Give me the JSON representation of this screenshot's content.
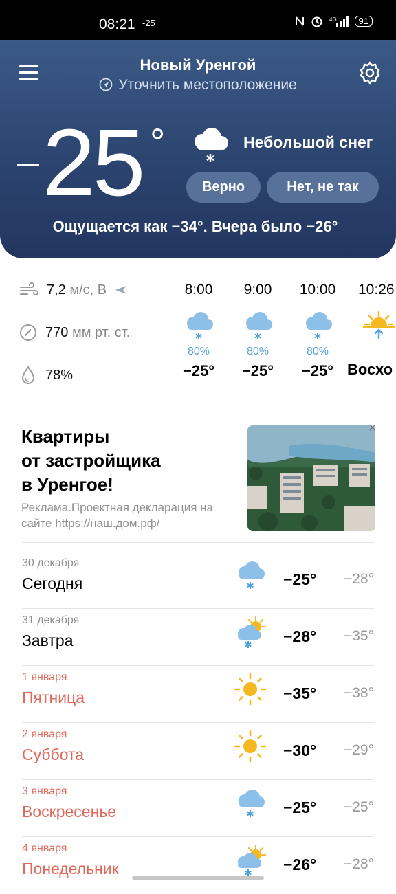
{
  "status_bar": {
    "time": "08:21",
    "temp": "-25",
    "battery": "91"
  },
  "header": {
    "city": "Новый Уренгой",
    "refine_location": "Уточнить местоположение",
    "temperature": "25",
    "degree": "°",
    "condition": "Небольшой снег",
    "btn_yes": "Верно",
    "btn_no": "Нет, не так",
    "feels_like": "Ощущается как −34°. Вчера было −26°"
  },
  "stats": {
    "wind_value": "7,2",
    "wind_unit": "м/с, В",
    "pressure_value": "770",
    "pressure_unit": "мм рт. ст.",
    "humidity": "78%"
  },
  "hourly": [
    {
      "time": "8:00",
      "prob": "80%",
      "temp": "−25°",
      "icon": "snow-cloud-icon"
    },
    {
      "time": "9:00",
      "prob": "80%",
      "temp": "−25°",
      "icon": "snow-cloud-icon"
    },
    {
      "time": "10:00",
      "prob": "80%",
      "temp": "−25°",
      "icon": "snow-cloud-icon"
    },
    {
      "time": "10:26",
      "prob": "",
      "temp": "Восхо",
      "icon": "sunrise-icon"
    }
  ],
  "ad": {
    "title_line1": "Квартиры",
    "title_line2": "от застройщика",
    "title_line3": "в Уренгое!",
    "subtitle": "Реклама.Проектная декларация на сайте https://наш.дом.рф/",
    "close": "×"
  },
  "forecast": [
    {
      "date": "30 декабря",
      "name": "Сегодня",
      "hi": "−25°",
      "lo": "−28°",
      "icon": "snow-cloud-icon",
      "weekend": false
    },
    {
      "date": "31 декабря",
      "name": "Завтра",
      "hi": "−28°",
      "lo": "−35°",
      "icon": "sun-cloud-snow-icon",
      "weekend": false
    },
    {
      "date": "1 января",
      "name": "Пятница",
      "hi": "−35°",
      "lo": "−38°",
      "icon": "sun-icon",
      "weekend": true
    },
    {
      "date": "2 января",
      "name": "Суббота",
      "hi": "−30°",
      "lo": "−29°",
      "icon": "sun-icon",
      "weekend": true
    },
    {
      "date": "3 января",
      "name": "Воскресенье",
      "hi": "−25°",
      "lo": "−25°",
      "icon": "snow-cloud-icon",
      "weekend": true
    },
    {
      "date": "4 января",
      "name": "Понедельник",
      "hi": "−26°",
      "lo": "−28°",
      "icon": "sun-cloud-snow-icon",
      "weekend": true
    }
  ],
  "colors": {
    "header": "#2c4470",
    "accent_red": "#e0695a",
    "snow_blue": "#5aa3d8",
    "sun_yellow": "#f5b820"
  }
}
